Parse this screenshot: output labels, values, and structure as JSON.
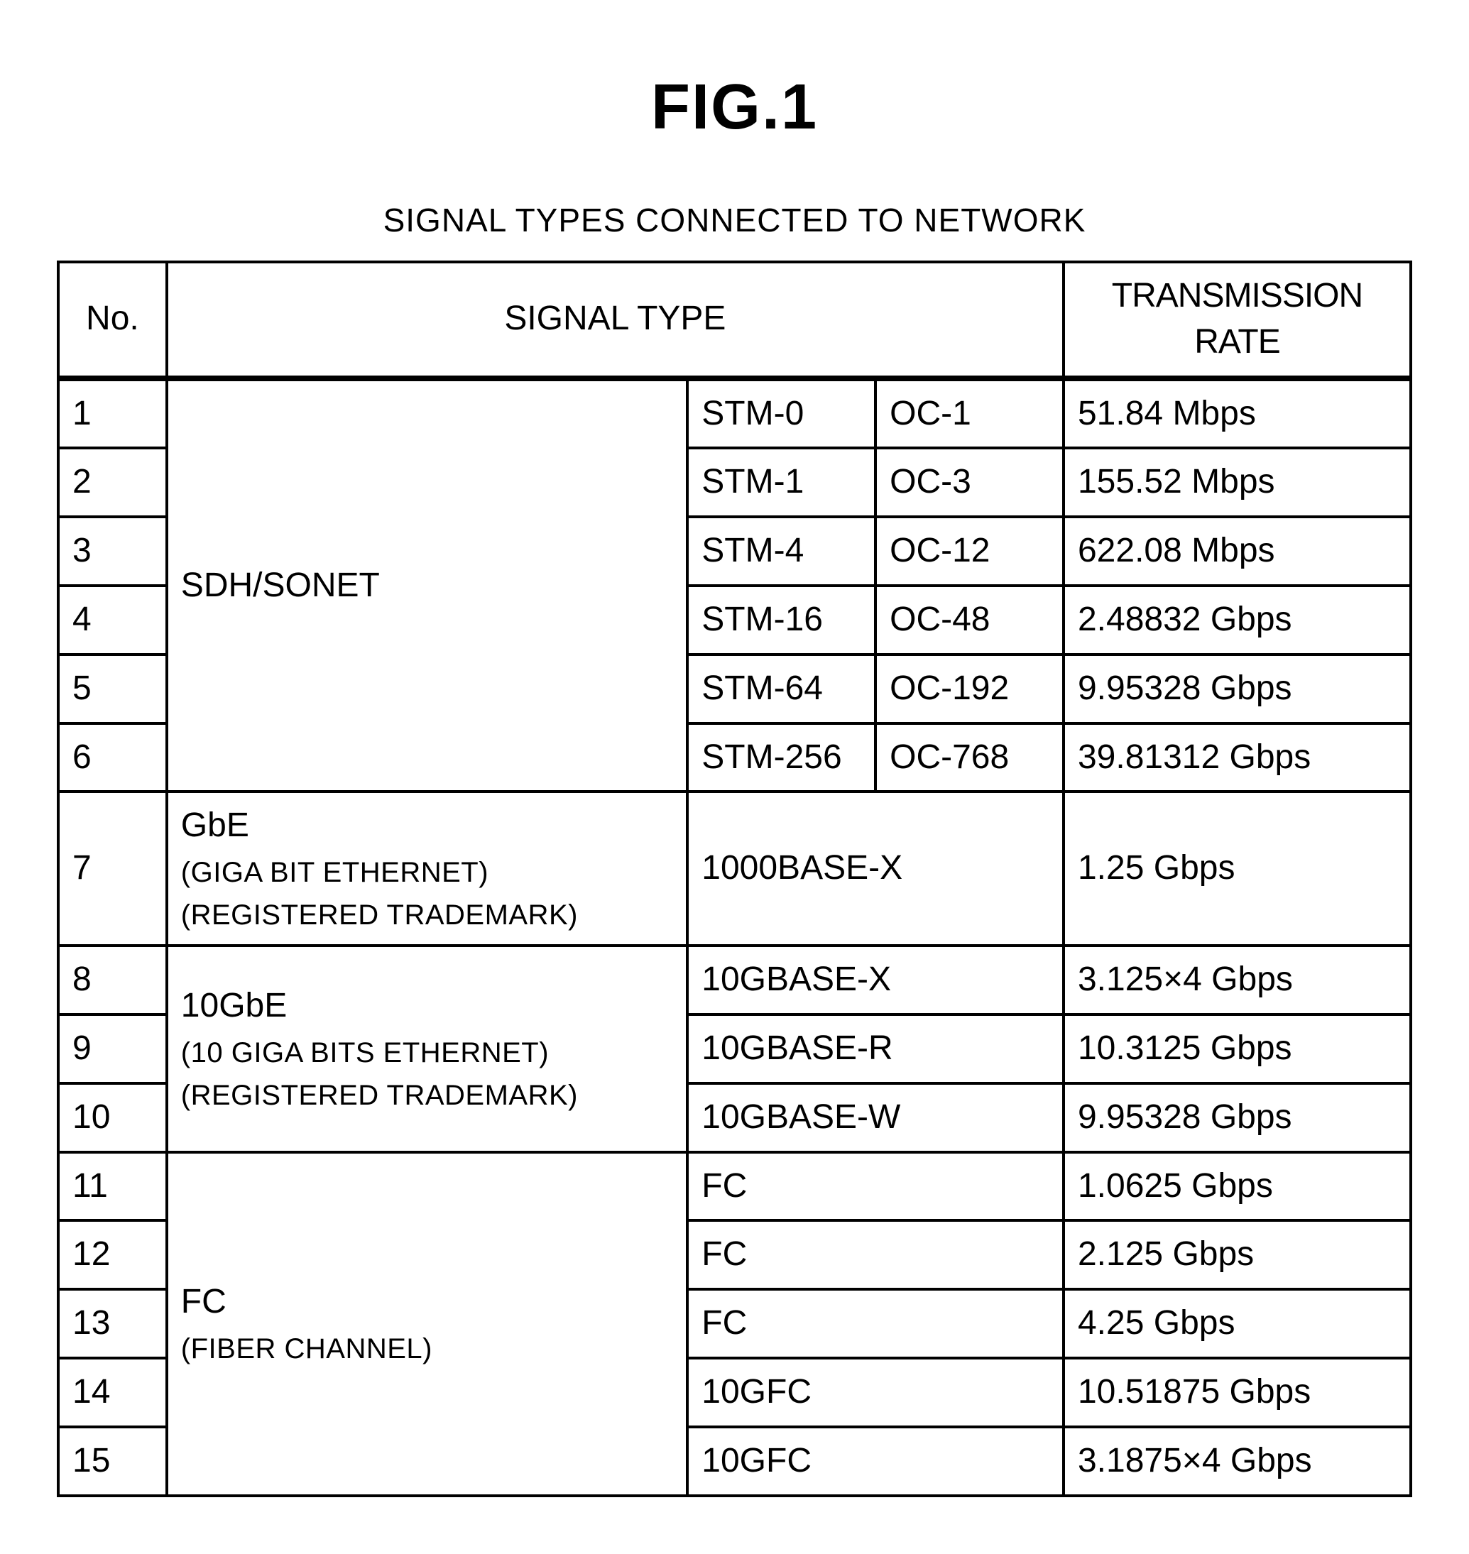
{
  "figureTitle": "FIG.1",
  "tableCaption": "SIGNAL TYPES CONNECTED TO NETWORK",
  "headers": {
    "no": "No.",
    "signalType": "SIGNAL TYPE",
    "transmissionRate": "TRANSMISSION RATE"
  },
  "categories": {
    "sdh": {
      "line1": "SDH/SONET"
    },
    "gbe": {
      "line1": "GbE",
      "line2": "(GIGA BIT ETHERNET)",
      "line3": "(REGISTERED TRADEMARK)"
    },
    "tengbe": {
      "line1": "10GbE",
      "line2": "(10 GIGA BITS ETHERNET)",
      "line3": "(REGISTERED TRADEMARK)"
    },
    "fc": {
      "line1": "FC",
      "line2": "(FIBER CHANNEL)"
    }
  },
  "rows": [
    {
      "no": "1",
      "sub1": "STM-0",
      "sub2": "OC-1",
      "rate": "51.84 Mbps"
    },
    {
      "no": "2",
      "sub1": "STM-1",
      "sub2": "OC-3",
      "rate": "155.52 Mbps"
    },
    {
      "no": "3",
      "sub1": "STM-4",
      "sub2": "OC-12",
      "rate": "622.08 Mbps"
    },
    {
      "no": "4",
      "sub1": "STM-16",
      "sub2": "OC-48",
      "rate": "2.48832 Gbps"
    },
    {
      "no": "5",
      "sub1": "STM-64",
      "sub2": "OC-192",
      "rate": "9.95328 Gbps"
    },
    {
      "no": "6",
      "sub1": "STM-256",
      "sub2": "OC-768",
      "rate": "39.81312 Gbps"
    },
    {
      "no": "7",
      "sub1_full": "1000BASE-X",
      "rate": "1.25 Gbps"
    },
    {
      "no": "8",
      "sub1_full": "10GBASE-X",
      "rate": "3.125×4 Gbps"
    },
    {
      "no": "9",
      "sub1_full": "10GBASE-R",
      "rate": "10.3125 Gbps"
    },
    {
      "no": "10",
      "sub1_full": "10GBASE-W",
      "rate": "9.95328 Gbps"
    },
    {
      "no": "11",
      "sub1_full": "FC",
      "rate": "1.0625 Gbps"
    },
    {
      "no": "12",
      "sub1_full": "FC",
      "rate": "2.125 Gbps"
    },
    {
      "no": "13",
      "sub1_full": "FC",
      "rate": "4.25 Gbps"
    },
    {
      "no": "14",
      "sub1_full": "10GFC",
      "rate": "10.51875 Gbps"
    },
    {
      "no": "15",
      "sub1_full": "10GFC",
      "rate": "3.1875×4 Gbps"
    }
  ]
}
